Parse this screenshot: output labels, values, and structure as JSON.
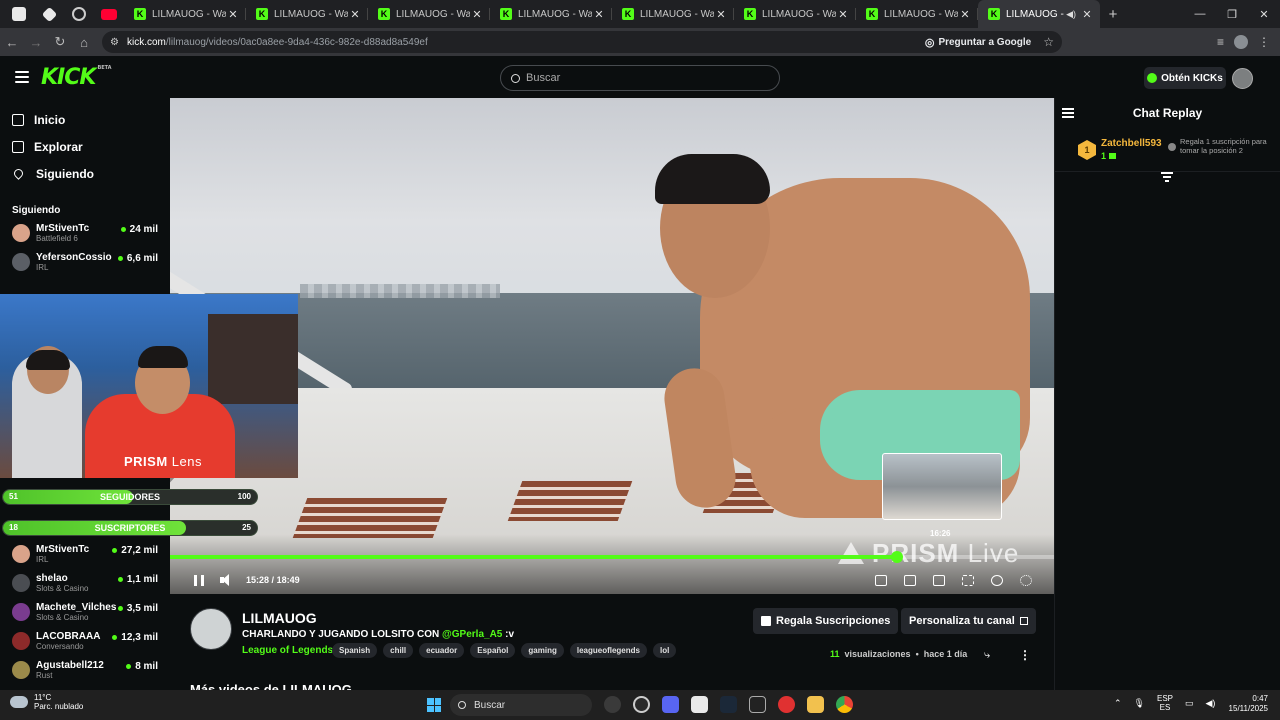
{
  "browser": {
    "tabs": [
      {
        "label": "LILMAUOG - Watch th",
        "active": false
      },
      {
        "label": "LILMAUOG - Watch th",
        "active": false
      },
      {
        "label": "LILMAUOG - Watch th",
        "active": false
      },
      {
        "label": "LILMAUOG - Watch th",
        "active": false
      },
      {
        "label": "LILMAUOG - Watch th",
        "active": false
      },
      {
        "label": "LILMAUOG - Watch th",
        "active": false
      },
      {
        "label": "LILMAUOG - Watch th",
        "active": false
      },
      {
        "label": "LILMAUOG - Wat",
        "active": true
      }
    ],
    "address": {
      "host": "kick.com",
      "path": "/lilmauog/videos/0ac0a8ee-9da4-436c-982e-d88ad8a549ef",
      "ask_google": "Preguntar a Google"
    }
  },
  "header": {
    "logo": "KICK",
    "logo_badge": "BETA",
    "search_placeholder": "Buscar",
    "get_kicks": "Obtén KICKs"
  },
  "sidebar": {
    "nav": [
      {
        "label": "Inicio"
      },
      {
        "label": "Explorar"
      },
      {
        "label": "Siguiendo"
      }
    ],
    "following_title": "Siguiendo",
    "following_top": [
      {
        "name": "MrStivenTc",
        "category": "Battlefield 6",
        "viewers": "24 mil"
      },
      {
        "name": "YefersonCossio",
        "category": "IRL",
        "viewers": "6,6 mil"
      }
    ],
    "following_bottom": [
      {
        "name": "MrStivenTc",
        "category": "IRL",
        "viewers": "27,2 mil"
      },
      {
        "name": "shelao",
        "category": "Slots & Casino",
        "viewers": "1,1 mil"
      },
      {
        "name": "Machete_Vilches",
        "category": "Slots & Casino",
        "viewers": "3,5 mil"
      },
      {
        "name": "LACOBRAAA",
        "category": "Conversando",
        "viewers": "12,3 mil"
      },
      {
        "name": "Agustabell212",
        "category": "Rust",
        "viewers": "8 mil"
      }
    ]
  },
  "overlay": {
    "lens_brand": "PRISM",
    "lens_word": "Lens",
    "goals": [
      {
        "label": "SEGUIDORES",
        "start": "51",
        "end": "100",
        "progress": 0.51
      },
      {
        "label": "SUSCRIPTORES",
        "start": "18",
        "end": "25",
        "progress": 0.72
      }
    ]
  },
  "video": {
    "watermark_brand": "PRISM",
    "watermark_word": "Live",
    "current_time": "15:28",
    "duration": "18:49",
    "time_separator": "/",
    "progress": 0.822,
    "preview_time": "16:26"
  },
  "chat": {
    "title": "Chat Replay",
    "gifter": {
      "rank": "1",
      "name": "Zatchbell593",
      "count": "1",
      "note": "Regala 1 suscripción para tomar la posición 2"
    }
  },
  "channel": {
    "name": "LILMAUOG",
    "title": "CHARLANDO Y JUGANDO LOLSITO CON",
    "mention": "@GPerla_A5",
    "title_suffix": ":v",
    "category": "League of Legends",
    "tags": [
      "Spanish",
      "chill",
      "ecuador",
      "Español",
      "gaming",
      "leagueoflegends",
      "lol"
    ],
    "gift_subs": "Regala Suscripciones",
    "customize": "Personaliza tu canal",
    "views_count": "11",
    "views_label": "visualizaciones",
    "ago": "hace 1 día",
    "more_videos": "Más videos de LILMAUOG"
  },
  "taskbar": {
    "temp": "11°C",
    "weather": "Parc. nublado",
    "search": "Buscar",
    "lang_top": "ESP",
    "lang_bottom": "ES",
    "time": "0:47",
    "date": "15/11/2025"
  },
  "colors": {
    "accent": "#53fc18",
    "background": "#0b0e0f",
    "gifter_gold": "#f5b83d"
  }
}
